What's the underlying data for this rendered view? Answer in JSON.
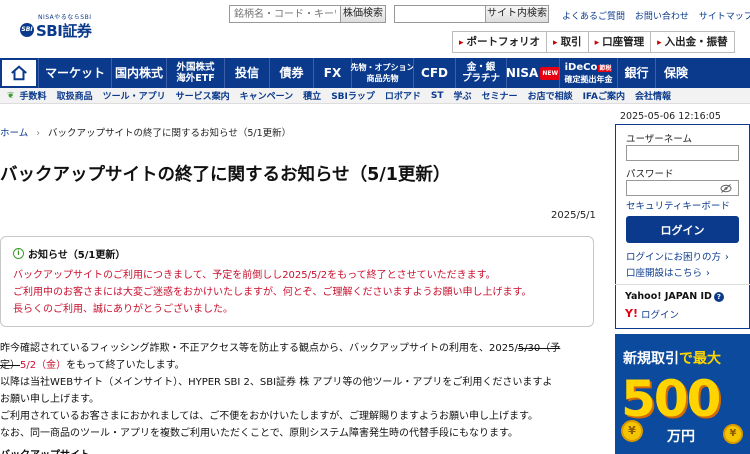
{
  "header": {
    "logo_small": "NISAやるならSBI",
    "logo_name": "SBI証券",
    "search_placeholder": "銘柄名・コード・キーワード",
    "search_button": "株価検索",
    "site_search_button": "サイト内検索",
    "links": [
      "よくあるご質問",
      "お問い合わせ",
      "サイトマップ"
    ],
    "quick_links": [
      "ポートフォリオ",
      "取引",
      "口座管理",
      "入出金・振替"
    ]
  },
  "main_nav": [
    {
      "label": "マーケット"
    },
    {
      "label": "国内株式"
    },
    {
      "label": "外国株式",
      "sub": "海外ETF"
    },
    {
      "label": "投信"
    },
    {
      "label": "債券"
    },
    {
      "label": "FX"
    },
    {
      "label": "先物・オプション",
      "sub": "商品先物"
    },
    {
      "label": "CFD"
    },
    {
      "label": "金・銀",
      "sub": "プラチナ"
    },
    {
      "label": "NISA",
      "badge": "NEW"
    },
    {
      "label": "iDeCo",
      "badge": "節税",
      "sub": "確定拠出年金"
    },
    {
      "label": "銀行"
    },
    {
      "label": "保険"
    }
  ],
  "sub_nav": [
    "手数料",
    "取扱商品",
    "ツール・アプリ",
    "サービス案内",
    "キャンペーン",
    "積立",
    "SBIラップ",
    "ロボアド",
    "ST",
    "学ぶ",
    "セミナー",
    "お店で相談",
    "IFAご案内",
    "会社情報"
  ],
  "breadcrumb": {
    "home": "ホーム",
    "current": "バックアップサイトの終了に関するお知らせ（5/1更新）"
  },
  "timestamp": "2025-05-06 12:16:05",
  "page_title": "バックアップサイトの終了に関するお知らせ（5/1更新）",
  "date": "2025/5/1",
  "notice": {
    "heading": "お知らせ（5/1更新）",
    "lines": [
      "バックアップサイトのご利用につきまして、予定を前倒しし2025/5/2をもって終了とさせていただきます。",
      "ご利用中のお客さまには大変ご迷惑をおかけいたしますが、何とぞ、ご理解くださいますようお願い申し上げます。",
      "長らくのご利用、誠にありがとうございました。"
    ]
  },
  "body": {
    "p1_a": "昨今確認されているフィッシング詐欺・不正アクセス等を防止する観点から、バックアップサイトの利用を、2025/",
    "p1_strike1": "5/30（予",
    "p1_strike2": "定）",
    "p1_red": "5/2（金）",
    "p1_b": "をもって終了いたします。",
    "p2": "以降は当社WEBサイト（メインサイト）、HYPER SBI 2、SBI証券 株 アプリ等の他ツール・アプリをご利用くださいますよ",
    "p2b": "お願い申し上げます。",
    "p3": "ご利用されているお客さまにおかれましては、ご不便をおかけいたしますが、ご理解賜りますようお願い申し上げます。",
    "p4": "なお、同一商品のツール・アプリを複数ご利用いただくことで、原則システム障害発生時の代替手段にもなります。",
    "cut_heading": "バックアップサイト"
  },
  "login": {
    "username_label": "ユーザーネーム",
    "password_label": "パスワード",
    "security_link": "セキュリティキーボード",
    "login_button": "ログイン",
    "trouble_link": "ログインにお困りの方",
    "open_account_link": "口座開設はこちら",
    "yahoo_title": "Yahoo! JAPAN ID",
    "yahoo_login": "ログイン"
  },
  "banner": {
    "line1_a": "新規取引",
    "line1_b": "で最大",
    "amount": "500",
    "unit": "万円"
  },
  "colors": {
    "brand": "#0b3a8c",
    "alert": "#c8102e",
    "accent_yellow": "#ffd400"
  }
}
